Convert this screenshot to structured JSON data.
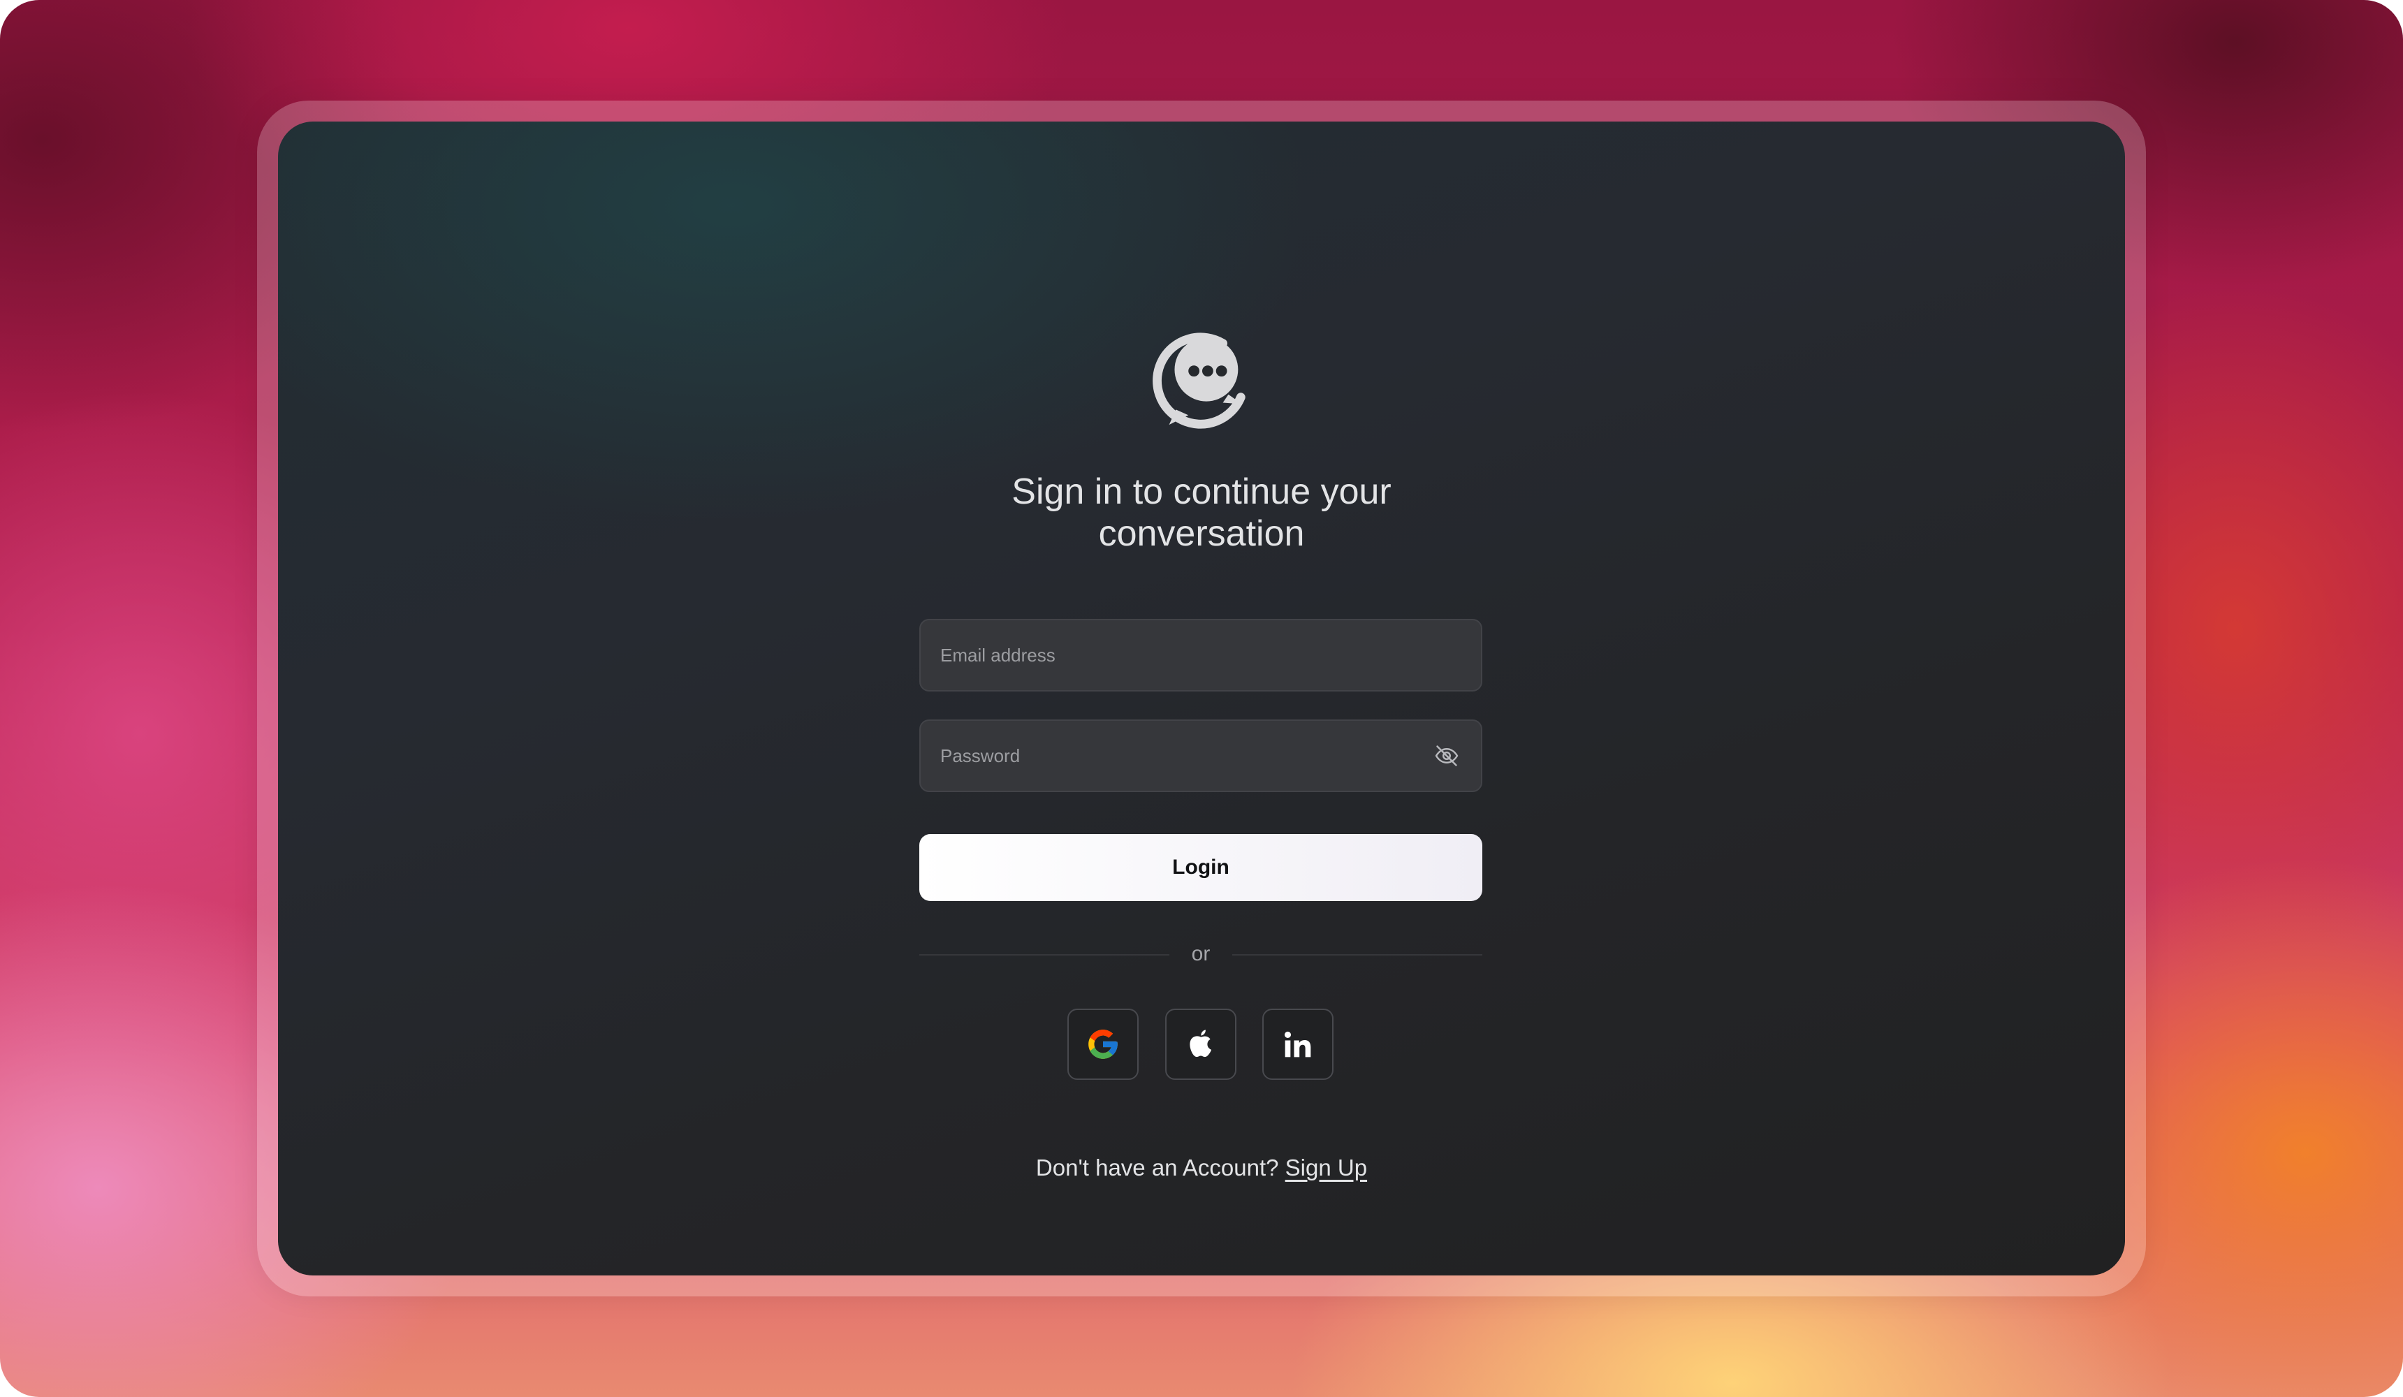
{
  "heading": "Sign in to continue your conversation",
  "email": {
    "placeholder": "Email address"
  },
  "password": {
    "placeholder": "Password"
  },
  "icons": {
    "logo": "chat-bubble-logo-icon",
    "password_toggle": "eye-off-icon",
    "google": "google-icon",
    "apple": "apple-icon",
    "linkedin": "linkedin-icon"
  },
  "login_label": "Login",
  "divider_text": "or",
  "footer": {
    "prompt": "Don't have an Account?",
    "signup_label": "Sign Up"
  },
  "colors": {
    "card_background": "#232629",
    "input_background": "#36373b",
    "button_background": "#ffffff",
    "text": "#e3e4e6"
  }
}
